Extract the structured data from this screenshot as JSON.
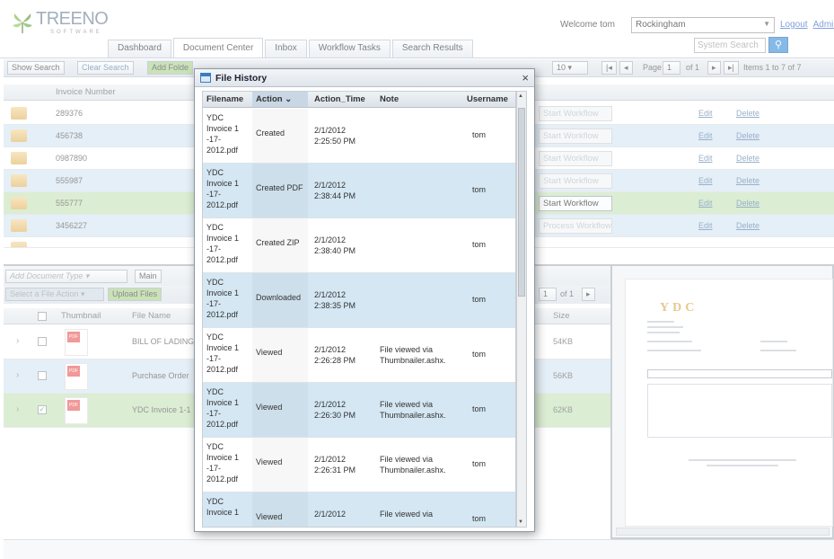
{
  "header": {
    "logo_name": "TREENO",
    "logo_sub": "SOFTWARE",
    "welcome": "Welcome tom",
    "site": "Rockingham",
    "logout": "Logout",
    "admin": "Administra",
    "search_placeholder": "System Search"
  },
  "tabs": [
    "Dashboard",
    "Document Center",
    "Inbox",
    "Workflow Tasks",
    "Search Results"
  ],
  "toolbar": {
    "show_search": "Show Search",
    "clear_search": "Clear Search",
    "add_folder": "Add Folde",
    "page_size": "10",
    "page_label": "Page",
    "page_num": "1",
    "page_of": "of 1",
    "items": "Items 1 to 7 of 7"
  },
  "grid": {
    "column": "Invoice Number",
    "rows": [
      {
        "invoice": "289376",
        "workflow": "Start Workflow",
        "enabled": false,
        "edit": "Edit",
        "delete": "Delete"
      },
      {
        "invoice": "456738",
        "workflow": "Start Workflow",
        "enabled": false,
        "edit": "Edit",
        "delete": "Delete"
      },
      {
        "invoice": "0987890",
        "workflow": "Start Workflow",
        "enabled": false,
        "edit": "Edit",
        "delete": "Delete"
      },
      {
        "invoice": "555987",
        "workflow": "Start Workflow",
        "enabled": false,
        "edit": "Edit",
        "delete": "Delete"
      },
      {
        "invoice": "555777",
        "workflow": "Start Workflow",
        "enabled": true,
        "edit": "Edit",
        "delete": "Delete"
      },
      {
        "invoice": "3456227",
        "workflow": "Process Workflow",
        "enabled": false,
        "edit": "Edit",
        "delete": "Delete"
      }
    ]
  },
  "lower": {
    "doc_type": "Add Document Type",
    "main": "Main",
    "file_action": "Select a File Action",
    "upload": "Upload Files",
    "page": "1",
    "of": "of 1",
    "col_thumb": "Thumbnail",
    "col_name": "File Name",
    "col_size": "Size",
    "files": [
      {
        "name": "BILL OF LADING",
        "size": "54KB",
        "checked": false
      },
      {
        "name": "Purchase Order",
        "size": "56KB",
        "checked": false
      },
      {
        "name": "YDC Invoice 1-1",
        "size": "62KB",
        "checked": true
      }
    ]
  },
  "preview": {
    "logo": "YDC"
  },
  "modal": {
    "title": "File History",
    "close": "×",
    "columns": {
      "filename": "Filename",
      "action": "Action",
      "time": "Action_Time",
      "note": "Note",
      "user": "Username"
    },
    "rows": [
      {
        "file": "YDC Invoice 1 -17- 2012.pdf",
        "action": "Created",
        "date": "2/1/2012",
        "time": "2:25:50 PM",
        "note": "",
        "note2": "",
        "user": "tom"
      },
      {
        "file": "YDC Invoice 1 -17- 2012.pdf",
        "action": "Created PDF",
        "date": "2/1/2012",
        "time": "2:38:44 PM",
        "note": "",
        "note2": "",
        "user": "tom"
      },
      {
        "file": "YDC Invoice 1 -17- 2012.pdf",
        "action": "Created ZIP",
        "date": "2/1/2012",
        "time": "2:38:40 PM",
        "note": "",
        "note2": "",
        "user": "tom"
      },
      {
        "file": "YDC Invoice 1 -17- 2012.pdf",
        "action": "Downloaded",
        "date": "2/1/2012",
        "time": "2:38:35 PM",
        "note": "",
        "note2": "",
        "user": "tom"
      },
      {
        "file": "YDC Invoice 1 -17- 2012.pdf",
        "action": "Viewed",
        "date": "2/1/2012",
        "time": "2:26:28 PM",
        "note": "File viewed via",
        "note2": "Thumbnailer.ashx.",
        "user": "tom"
      },
      {
        "file": "YDC Invoice 1 -17- 2012.pdf",
        "action": "Viewed",
        "date": "2/1/2012",
        "time": "2:26:30 PM",
        "note": "File viewed via",
        "note2": "Thumbnailer.ashx.",
        "user": "tom"
      },
      {
        "file": "YDC Invoice 1 -17- 2012.pdf",
        "action": "Viewed",
        "date": "2/1/2012",
        "time": "2:26:31 PM",
        "note": "File viewed via",
        "note2": "Thumbnailer.ashx.",
        "user": "tom"
      },
      {
        "file": "YDC Invoice 1",
        "action": "Viewed",
        "date": "2/1/2012",
        "time": "",
        "note": "File viewed via",
        "note2": "",
        "user": "tom"
      }
    ]
  }
}
